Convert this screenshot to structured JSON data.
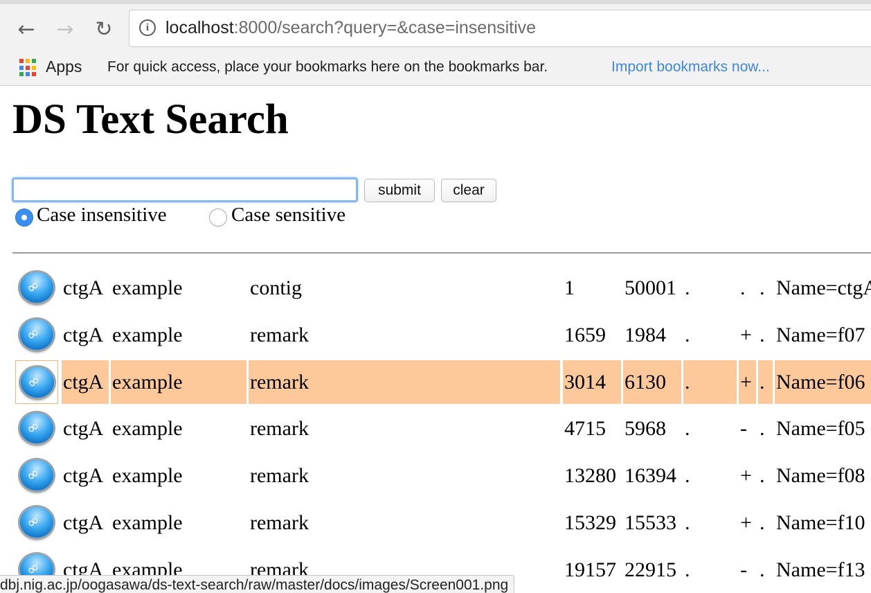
{
  "browser": {
    "url_host": "localhost",
    "url_rest": ":8000/search?query=&case=insensitive",
    "apps_label": "Apps",
    "bookmarks_hint": "For quick access, place your bookmarks here on the bookmarks bar.",
    "import_link": "Import bookmarks now..."
  },
  "page": {
    "title": "DS Text Search",
    "search_value": "",
    "submit_label": "submit",
    "clear_label": "clear",
    "case_insensitive_label": "Case insensitive",
    "case_sensitive_label": "Case sensitive",
    "selected_case": "insensitive"
  },
  "results": [
    {
      "seqid": "ctgA",
      "source": "example",
      "type": "contig",
      "start": "1",
      "end": "50001",
      "score": ".",
      "strand": ".",
      "phase": ".",
      "attributes": "Name=ctgA",
      "highlight": false
    },
    {
      "seqid": "ctgA",
      "source": "example",
      "type": "remark",
      "start": "1659",
      "end": "1984",
      "score": ".",
      "strand": "+",
      "phase": ".",
      "attributes": "Name=f07",
      "highlight": false
    },
    {
      "seqid": "ctgA",
      "source": "example",
      "type": "remark",
      "start": "3014",
      "end": "6130",
      "score": ".",
      "strand": "+",
      "phase": ".",
      "attributes": "Name=f06",
      "highlight": true
    },
    {
      "seqid": "ctgA",
      "source": "example",
      "type": "remark",
      "start": "4715",
      "end": "5968",
      "score": ".",
      "strand": "-",
      "phase": ".",
      "attributes": "Name=f05",
      "highlight": false
    },
    {
      "seqid": "ctgA",
      "source": "example",
      "type": "remark",
      "start": "13280",
      "end": "16394",
      "score": ".",
      "strand": "+",
      "phase": ".",
      "attributes": "Name=f08",
      "highlight": false
    },
    {
      "seqid": "ctgA",
      "source": "example",
      "type": "remark",
      "start": "15329",
      "end": "15533",
      "score": ".",
      "strand": "+",
      "phase": ".",
      "attributes": "Name=f10",
      "highlight": false
    },
    {
      "seqid": "ctgA",
      "source": "example",
      "type": "remark",
      "start": "19157",
      "end": "22915",
      "score": ".",
      "strand": "-",
      "phase": ".",
      "attributes": "Name=f13",
      "highlight": false
    }
  ],
  "status_bar": "dbj.nig.ac.jp/oogasawa/ds-text-search/raw/master/docs/images/Screen001.png",
  "colors": {
    "highlight_row": "#fdc99b",
    "link_blue": "#3e87e0",
    "focus_ring": "#86b7f2"
  }
}
